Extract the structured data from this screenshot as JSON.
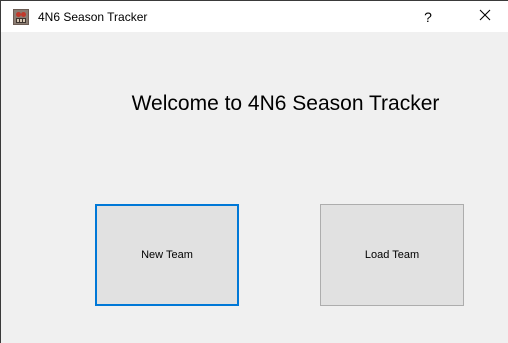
{
  "window": {
    "title": "4N6 Season Tracker",
    "app_icon": "app-logo-icon",
    "help_label": "?",
    "close_icon": "close-icon"
  },
  "main": {
    "welcome_text": "Welcome to 4N6 Season Tracker",
    "new_team_label": "New Team",
    "load_team_label": "Load Team"
  },
  "colors": {
    "focus_border": "#0078d7",
    "button_bg": "#e1e1e1",
    "window_bg": "#f0f0f0"
  }
}
